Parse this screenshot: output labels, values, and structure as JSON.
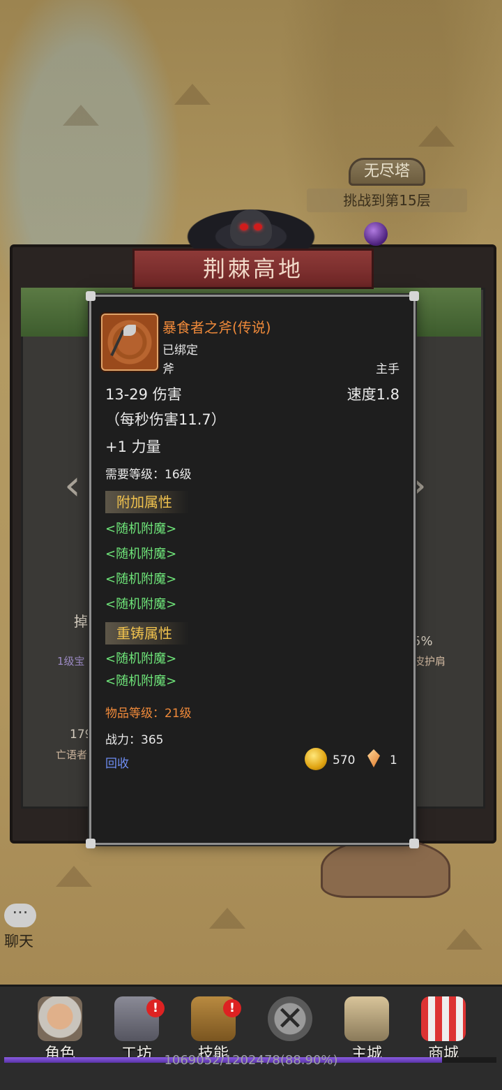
{
  "tower": {
    "title": "无尽塔",
    "subtitle": "挑战到第15层"
  },
  "region": {
    "title": "荆棘高地"
  },
  "background": {
    "drop_label": "掉",
    "left_item_caption": "1级宝",
    "left_item_count": "179",
    "left_item_name": "亡语者",
    "right_percent": "5%",
    "right_item_caption": "皮护肩"
  },
  "item": {
    "name": "暴食者之斧(传说)",
    "bound": "已绑定",
    "type": "斧",
    "slot": "主手",
    "damage": "13-29 伤害",
    "speed": "速度1.8",
    "dps": "（每秒伤害11.7）",
    "stat": "+1 力量",
    "requirement": "需要等级：16级",
    "extra_title": "附加属性",
    "extra_enchants": [
      "<随机附魔>",
      "<随机附魔>",
      "<随机附魔>",
      "<随机附魔>"
    ],
    "reforge_title": "重铸属性",
    "reforge_enchants": [
      "<随机附魔>",
      "<随机附魔>"
    ],
    "item_level": "物品等级：21级",
    "power": "战力：365",
    "recycle": "回收",
    "gold_value": "570",
    "gem_value": "1",
    "name_color": "#f08a3a",
    "enchant_color": "#6fe67a",
    "section_color": "#f0c24e"
  },
  "chat": {
    "label": "聊天",
    "bubble": "···"
  },
  "nav": [
    {
      "label": "角色",
      "icon": "hero-portrait-icon",
      "badge": ""
    },
    {
      "label": "工坊",
      "icon": "anvil-icon",
      "badge": "!"
    },
    {
      "label": "技能",
      "icon": "skill-book-icon",
      "badge": "!"
    },
    {
      "label": "",
      "icon": "close-x-icon",
      "badge": ""
    },
    {
      "label": "主城",
      "icon": "castle-icon",
      "badge": ""
    },
    {
      "label": "商城",
      "icon": "shop-stall-icon",
      "badge": ""
    }
  ],
  "xp": {
    "text": "1069052/1202478(88.90%)",
    "progress": 0.889
  }
}
